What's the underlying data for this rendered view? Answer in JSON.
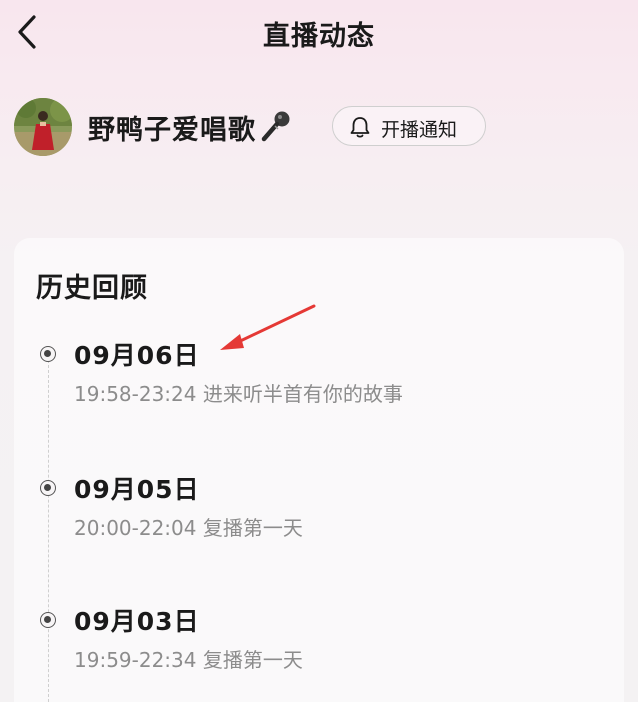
{
  "header": {
    "title": "直播动态",
    "back_icon": "chevron-left-icon"
  },
  "anchor": {
    "name": "野鸭子爱唱歌",
    "name_icon": "microphone-icon",
    "notify_button": {
      "label": "开播通知",
      "icon": "bell-icon"
    }
  },
  "history": {
    "title": "历史回顾",
    "items": [
      {
        "date": "09月06日",
        "time": "19:58-23:24",
        "title": "进来听半首有你的故事"
      },
      {
        "date": "09月05日",
        "time": "20:00-22:04",
        "title": "复播第一天"
      },
      {
        "date": "09月03日",
        "time": "19:59-22:34",
        "title": "复播第一天"
      }
    ]
  },
  "colors": {
    "annotation_arrow": "#e53935",
    "text_primary": "#1a1a1a",
    "text_secondary": "#8c8c8c"
  }
}
